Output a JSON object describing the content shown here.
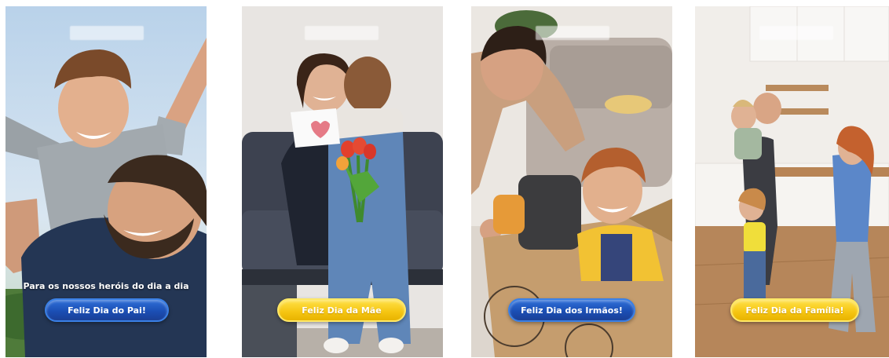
{
  "cards": [
    {
      "tagline": "Para os nossos heróis do dia a dia",
      "button_label": "Feliz Dia do Pai!",
      "button_color": "#1b4fb5",
      "scene": "father-carrying-son-photo"
    },
    {
      "tagline": "",
      "button_label": "Feliz Dia da Mãe",
      "button_color": "#f5c511",
      "scene": "mother-hugging-child-photo"
    },
    {
      "tagline": "",
      "button_label": "Feliz Dia dos Irmãos!",
      "button_color": "#1b4fb5",
      "scene": "siblings-playing-box-photo"
    },
    {
      "tagline": "",
      "button_label": "Feliz Dia da Família!",
      "button_color": "#f5c511",
      "scene": "family-dancing-kitchen-photo"
    }
  ]
}
